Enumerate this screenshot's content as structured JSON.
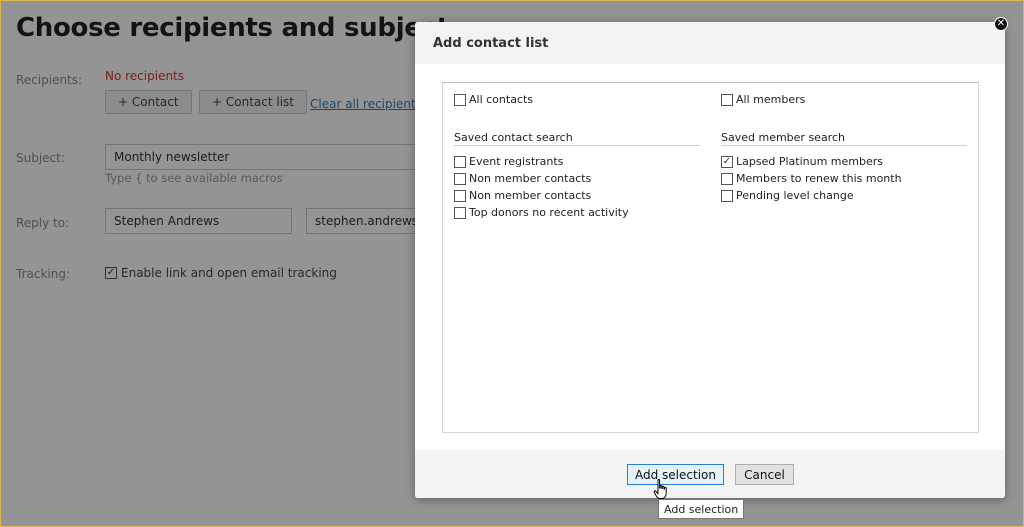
{
  "page": {
    "title": "Choose recipients and subject",
    "recipients_label": "Recipients:",
    "no_recipients": "No recipients",
    "add_contact_label": "+ Contact",
    "add_contact_list_label": "+ Contact list",
    "clear_all_label": "Clear all recipients",
    "subject_label": "Subject:",
    "subject_value": "Monthly newsletter",
    "subject_hint": "Type { to see available macros",
    "reply_to_label": "Reply to:",
    "reply_name": "Stephen Andrews",
    "reply_email": "stephen.andrews@",
    "tracking_label": "Tracking:",
    "tracking_text": "Enable link and open email tracking",
    "tracking_checked": true
  },
  "modal": {
    "title": "Add contact list",
    "left_top": {
      "label": "All contacts",
      "checked": false
    },
    "right_top": {
      "label": "All members",
      "checked": false
    },
    "left_group": {
      "heading": "Saved contact search",
      "items": [
        {
          "label": "Event registrants",
          "checked": false
        },
        {
          "label": "Non member contacts",
          "checked": false
        },
        {
          "label": "Non member contacts",
          "checked": false
        },
        {
          "label": "Top donors no recent activity",
          "checked": false
        }
      ]
    },
    "right_group": {
      "heading": "Saved member search",
      "items": [
        {
          "label": "Lapsed Platinum members",
          "checked": true
        },
        {
          "label": "Members to renew this month",
          "checked": false
        },
        {
          "label": "Pending level change",
          "checked": false
        }
      ]
    },
    "add_selection_label": "Add selection",
    "cancel_label": "Cancel",
    "tooltip": "Add selection"
  },
  "icons": {
    "close": "close-icon",
    "checkbox": "checkbox-icon",
    "cursor": "hand-pointer-icon"
  },
  "colors": {
    "accent": "#2c7fd0",
    "error": "#dd3333",
    "link": "#2a7cc7",
    "frame": "#d9b84a"
  }
}
